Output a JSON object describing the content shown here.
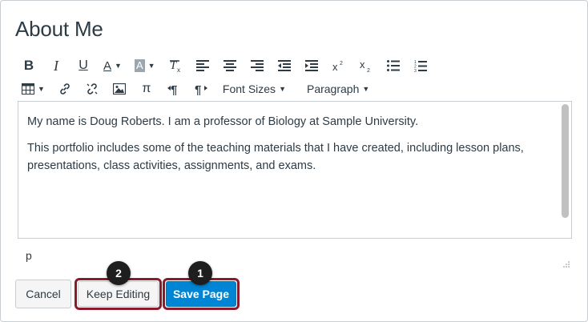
{
  "page": {
    "title": "About Me"
  },
  "toolbar": {
    "bold": "B",
    "italic": "I",
    "underline": "U",
    "text_color": "A",
    "highlight": "A",
    "font_sizes_label": "Font Sizes",
    "paragraph_label": "Paragraph",
    "pi_symbol": "π"
  },
  "editor": {
    "paragraphs": [
      "My name is Doug Roberts. I am a professor of Biology at Sample University.",
      "This portfolio includes some of the teaching materials that I have created, including lesson plans, presentations, class activities, assignments, and exams."
    ],
    "path": "p"
  },
  "buttons": {
    "cancel": "Cancel",
    "keep_editing": "Keep Editing",
    "save_page": "Save Page"
  },
  "callouts": {
    "keep_editing": "2",
    "save_page": "1"
  },
  "colors": {
    "save": "#0084d4",
    "highlight_outline": "#8b1a2a",
    "badge": "#1e1e1e"
  },
  "icons": [
    "bold-icon",
    "italic-icon",
    "underline-icon",
    "text-color-icon",
    "highlight-color-icon",
    "clear-format-icon",
    "align-left-icon",
    "align-center-icon",
    "align-right-icon",
    "outdent-icon",
    "indent-icon",
    "superscript-icon",
    "subscript-icon",
    "bullet-list-icon",
    "numbered-list-icon",
    "table-icon",
    "link-icon",
    "unlink-icon",
    "image-icon",
    "math-icon",
    "ltr-icon",
    "rtl-icon",
    "resize-grip-icon"
  ]
}
